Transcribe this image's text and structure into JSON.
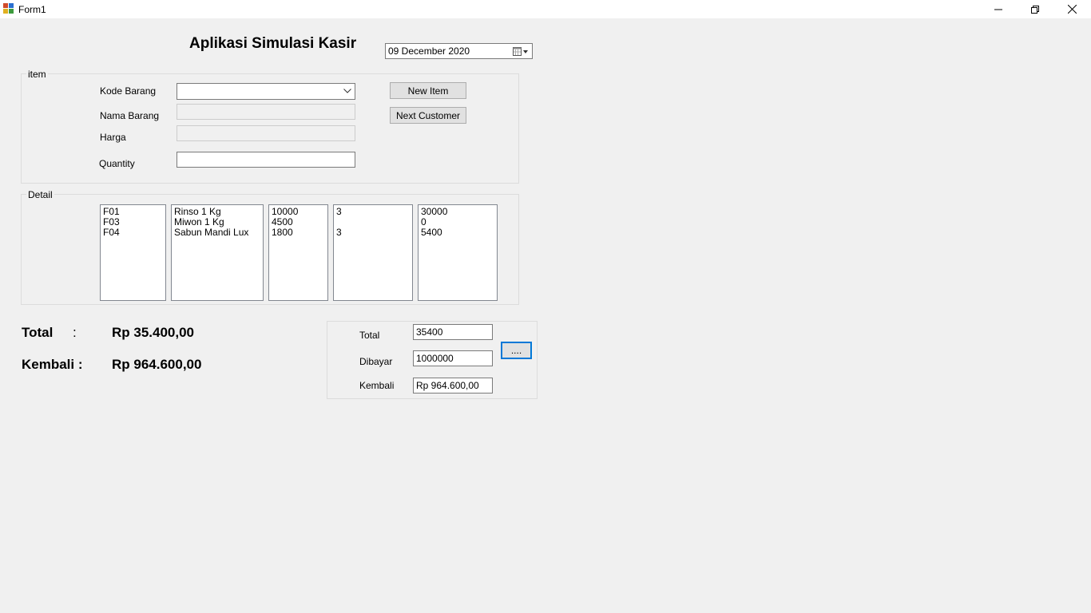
{
  "window": {
    "title": "Form1",
    "controls": {
      "minimize": "minimize-icon",
      "maximize": "restore-icon",
      "close": "close-icon"
    }
  },
  "app_title": "Aplikasi Simulasi Kasir",
  "date_picker": {
    "value": "09 December 2020",
    "icon": "calendar-icon"
  },
  "item_group": {
    "legend": "item",
    "kode_barang_label": "Kode Barang",
    "kode_barang_value": "",
    "nama_barang_label": "Nama Barang",
    "nama_barang_value": "",
    "harga_label": "Harga",
    "harga_value": "",
    "quantity_label": "Quantity",
    "quantity_value": "",
    "new_item_button": "New Item",
    "next_customer_button": "Next Customer"
  },
  "detail_group": {
    "legend": "Detail",
    "lists": [
      [
        "F01",
        "F03",
        "F04"
      ],
      [
        "Rinso 1 Kg",
        "Miwon 1 Kg",
        "Sabun Mandi Lux"
      ],
      [
        "10000",
        "4500",
        "1800"
      ],
      [
        "3",
        "",
        "3"
      ],
      [
        "30000",
        "0",
        "5400"
      ]
    ]
  },
  "summary": {
    "total_label": "Total",
    "total_colon": ":",
    "total_value": "Rp 35.400,00",
    "kembali_label": "Kembali :",
    "kembali_value": "Rp 964.600,00"
  },
  "payment_group": {
    "total_label": "Total",
    "total_value": "35400",
    "dibayar_label": "Dibayar",
    "dibayar_value": "1000000",
    "kembali_label": "Kembali",
    "kembali_value": "Rp 964.600,00",
    "calc_button": "...."
  },
  "colors": {
    "focus": "#0078d7",
    "background": "#f0f0f0",
    "titlebar": "#ffffff"
  }
}
